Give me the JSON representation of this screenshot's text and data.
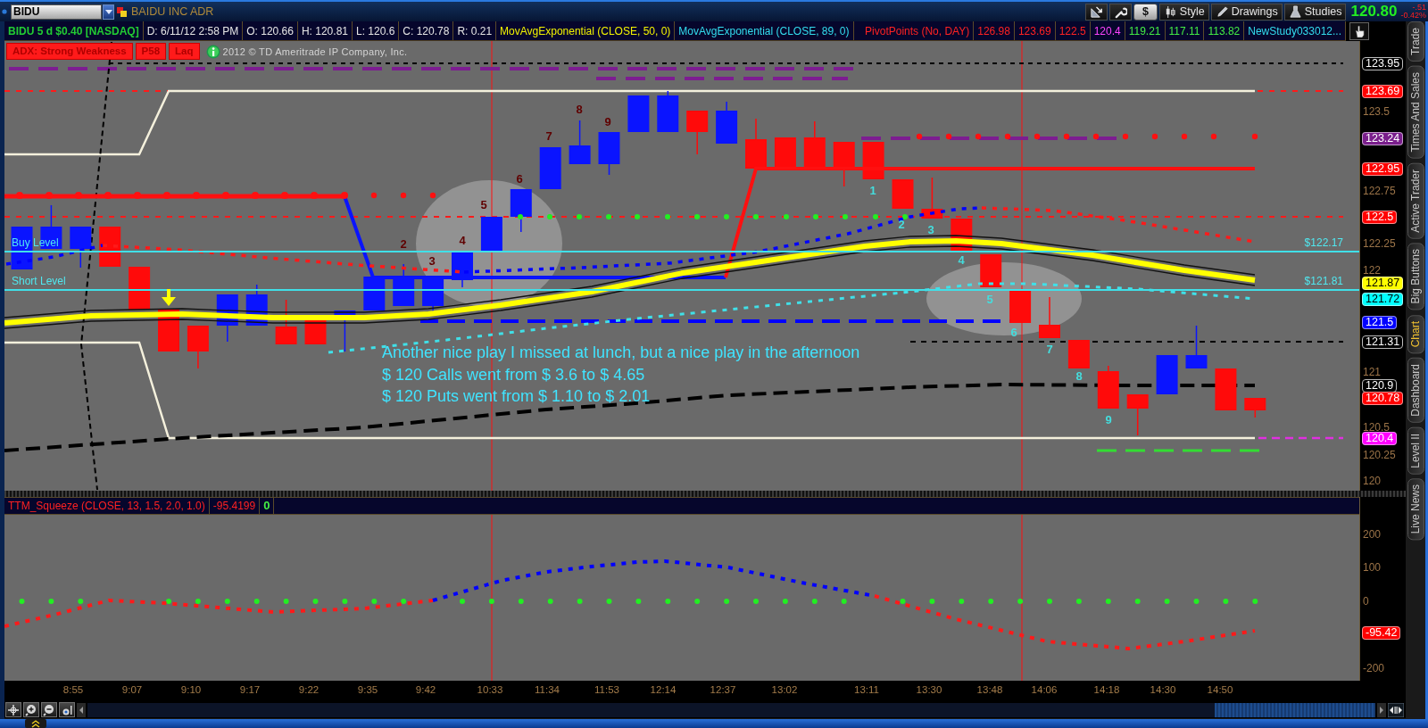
{
  "toolbar": {
    "symbol": "BIDU",
    "company": "BAIDU INC ADR",
    "buttons": [
      {
        "kind": "tools"
      },
      {
        "kind": "wrench"
      },
      {
        "kind": "dollar",
        "label": "$"
      },
      {
        "kind": "style",
        "label": "Style"
      },
      {
        "kind": "drawings",
        "label": "Drawings"
      },
      {
        "kind": "studies",
        "label": "Studies"
      }
    ],
    "last_price": "120.80",
    "change": "-.51",
    "change_percent": "-0.42%"
  },
  "study_bar": {
    "items": [
      {
        "text": "BIDU 5 d $0.40 [NASDAQ]",
        "color": "#22cc33"
      },
      {
        "text": "D: 6/11/12 2:58 PM",
        "color": "#e6e6e6"
      },
      {
        "text": "O: 120.66",
        "color": "#e6e6e6"
      },
      {
        "text": "H: 120.81",
        "color": "#e6e6e6"
      },
      {
        "text": "L: 120.6",
        "color": "#e6e6e6"
      },
      {
        "text": "C: 120.78",
        "color": "#e6e6e6"
      },
      {
        "text": "R: 0.21",
        "color": "#e6e6e6"
      },
      {
        "text": "MovAvgExponential (CLOSE, 50, 0)",
        "color": "#f2f200"
      },
      {
        "text": "MovAvgExponential (CLOSE, 89, 0)",
        "color": "#33ddee"
      }
    ],
    "pivot_items": [
      {
        "text": "PivotPoints (No, DAY)",
        "color": "#ff2222"
      },
      {
        "text": "126.98",
        "color": "#ff2222"
      },
      {
        "text": "123.69",
        "color": "#ff2222"
      },
      {
        "text": "122.5",
        "color": "#ff2222"
      },
      {
        "text": "120.4",
        "color": "#ff44ff"
      },
      {
        "text": "119.21",
        "color": "#44ee44"
      },
      {
        "text": "117.11",
        "color": "#44ee44"
      },
      {
        "text": "113.82",
        "color": "#44ee44"
      },
      {
        "text": "NewStudy033012...",
        "color": "#33ddee"
      }
    ]
  },
  "chart": {
    "badges": [
      "ADX: Strong Weakness",
      "P58",
      "Laq"
    ],
    "copyright": "2012 © TD Ameritrade IP Company, Inc.",
    "level_lines": [
      {
        "label": "Buy Level",
        "price": "$122.17"
      },
      {
        "label": "Short Level",
        "price": "$121.81"
      }
    ],
    "note": [
      "Another nice play I missed at lunch, but a nice play in the afternoon",
      "$ 120 Calls went from $ 3.6 to $ 4.65",
      "$ 120 Puts went from $ 1.10 to $ 2.01"
    ],
    "sequence_labels": [
      {
        "text": "2",
        "color": "#600000"
      },
      {
        "text": "3",
        "color": "#600000"
      },
      {
        "text": "4",
        "color": "#600000"
      },
      {
        "text": "5",
        "color": "#600000"
      },
      {
        "text": "6",
        "color": "#600000"
      },
      {
        "text": "7",
        "color": "#600000"
      },
      {
        "text": "8",
        "color": "#600000"
      },
      {
        "text": "9",
        "color": "#600000"
      },
      {
        "text": "1",
        "color": "#44dddd"
      },
      {
        "text": "2",
        "color": "#44dddd"
      },
      {
        "text": "3",
        "color": "#44dddd"
      },
      {
        "text": "4",
        "color": "#44dddd"
      },
      {
        "text": "5",
        "color": "#44dddd"
      },
      {
        "text": "6",
        "color": "#44dddd"
      },
      {
        "text": "7",
        "color": "#44dddd"
      },
      {
        "text": "8",
        "color": "#44dddd"
      },
      {
        "text": "9",
        "color": "#44dddd"
      }
    ],
    "price_ticks": [
      "123.5",
      "122.75",
      "122.25",
      "122",
      "121",
      "120.5",
      "120.25",
      "120"
    ],
    "price_tags": [
      {
        "text": "123.95",
        "color": "#000000"
      },
      {
        "text": "123.69",
        "color": "#ff0000"
      },
      {
        "text": "123.24",
        "color": "#7a1f8c"
      },
      {
        "text": "122.95",
        "color": "#ff0000"
      },
      {
        "text": "122.5",
        "color": "#ff0000"
      },
      {
        "text": "121.87",
        "color": "#ffff00"
      },
      {
        "text": "121.72",
        "color": "#00ffff"
      },
      {
        "text": "121.5",
        "color": "#0000ff"
      },
      {
        "text": "121.31",
        "color": "#000000"
      },
      {
        "text": "120.9",
        "color": "#000000"
      },
      {
        "text": "120.78",
        "color": "#ff0000"
      },
      {
        "text": "120.4",
        "color": "#ff00ff"
      }
    ]
  },
  "lower_panel": {
    "legend": [
      {
        "text": "TTM_Squeeze (CLOSE, 13, 1.5, 2.0, 1.0)",
        "color": "#ff2222"
      },
      {
        "text": "-95.4199",
        "color": "#ff2222"
      },
      {
        "text": "0",
        "color": "#44ee44"
      }
    ],
    "ticks": [
      "200",
      "100",
      "0",
      "-200"
    ],
    "tag": {
      "text": "-95.42",
      "color": "#ff0000"
    }
  },
  "time_axis": [
    "8:55",
    "9:07",
    "9:10",
    "9:17",
    "9:22",
    "9:35",
    "9:42",
    "10:33",
    "11:34",
    "11:53",
    "12:14",
    "12:37",
    "13:02",
    "13:11",
    "13:30",
    "13:48",
    "14:06",
    "14:18",
    "14:30",
    "14:50"
  ],
  "side_tabs": [
    {
      "label": "Trade",
      "selected": false
    },
    {
      "label": "Times And Sales",
      "selected": false
    },
    {
      "label": "Active Trader",
      "selected": false
    },
    {
      "label": "Big Buttons",
      "selected": false
    },
    {
      "label": "Chart",
      "selected": true
    },
    {
      "label": "Dashboard",
      "selected": false
    },
    {
      "label": "Level II",
      "selected": false
    },
    {
      "label": "Live News",
      "selected": false
    }
  ]
}
